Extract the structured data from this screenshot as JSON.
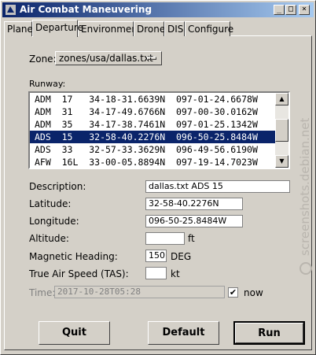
{
  "window": {
    "title": "Air Combat Maneuvering",
    "controls": [
      "_",
      "□",
      "×"
    ]
  },
  "tabs": [
    {
      "label": "Plane",
      "active": false
    },
    {
      "label": "Departure",
      "active": true
    },
    {
      "label": "Environment",
      "active": false
    },
    {
      "label": "Drones",
      "active": false
    },
    {
      "label": "DIS",
      "active": false
    },
    {
      "label": "Configure",
      "active": false
    }
  ],
  "zone": {
    "label": "Zone:",
    "value": "zones/usa/dallas.txt"
  },
  "runway": {
    "label": "Runway:",
    "rows": [
      {
        "text": "ADM  17   34-18-31.6639N  097-01-24.6678W",
        "selected": false
      },
      {
        "text": "ADM  31   34-17-49.6766N  097-00-30.0162W",
        "selected": false
      },
      {
        "text": "ADM  35   34-17-38.7461N  097-01-25.1342W",
        "selected": false
      },
      {
        "text": "ADS  15   32-58-40.2276N  096-50-25.8484W",
        "selected": true
      },
      {
        "text": "ADS  33   32-57-33.3629N  096-49-56.6190W",
        "selected": false
      },
      {
        "text": "AFW  16L  33-00-05.8894N  097-19-14.7023W",
        "selected": false
      }
    ]
  },
  "form": {
    "description": {
      "label": "Description:",
      "value": "dallas.txt ADS 15"
    },
    "latitude": {
      "label": "Latitude:",
      "value": "32-58-40.2276N"
    },
    "longitude": {
      "label": "Longitude:",
      "value": "096-50-25.8484W"
    },
    "altitude": {
      "label": "Altitude:",
      "value": "",
      "unit": "ft"
    },
    "heading": {
      "label": "Magnetic Heading:",
      "value": "150",
      "unit": "DEG"
    },
    "tas": {
      "label": "True Air Speed (TAS):",
      "value": "",
      "unit": "kt"
    },
    "time": {
      "label": "Time:",
      "value": "2017-10-28T05:28",
      "now_label": "now",
      "now_checked": true
    }
  },
  "buttons": {
    "quit": "Quit",
    "default": "Default",
    "run": "Run"
  },
  "watermark": {
    "text": "screenshots.debian.net"
  }
}
